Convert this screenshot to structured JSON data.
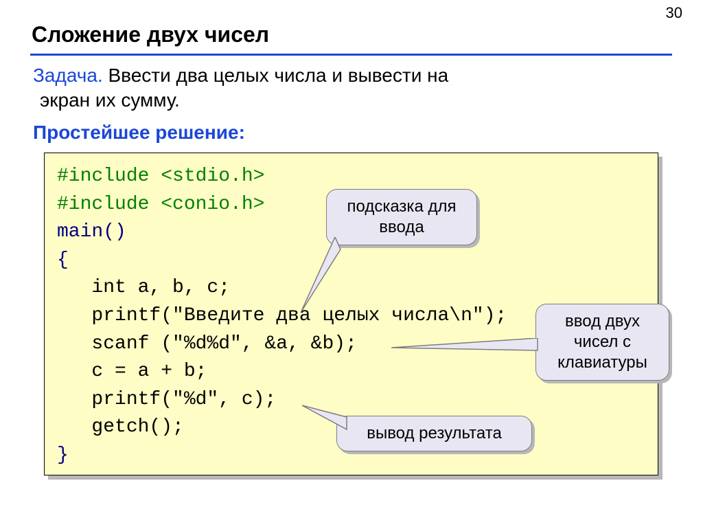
{
  "page_number": "30",
  "title": "Сложение двух чисел",
  "task_label": "Задача.",
  "task_text_1": " Ввести два целых числа и вывести на",
  "task_text_2": "экран их сумму.",
  "heading2": "Простейшее решение:",
  "code": {
    "l1a": "#include ",
    "l1b": "<stdio.h>",
    "l2a": "#include ",
    "l2b": "<conio.h>",
    "l3": "main()",
    "l4": "{",
    "l5": "   int a, b, c;",
    "l6": "   printf(\"Введите два целых числа\\n\");",
    "l7": "   scanf (\"%d%d\", &a, &b);",
    "l8": "   c = a + b;",
    "l9": "   printf(\"%d\", c);",
    "l10": "   getch();",
    "l11": "}"
  },
  "callouts": {
    "c1_line1": "подсказка для",
    "c1_line2": "ввода",
    "c2_line1": "ввод двух",
    "c2_line2": "чисел с",
    "c2_line3": "клавиатуры",
    "c3": "вывод результата"
  }
}
